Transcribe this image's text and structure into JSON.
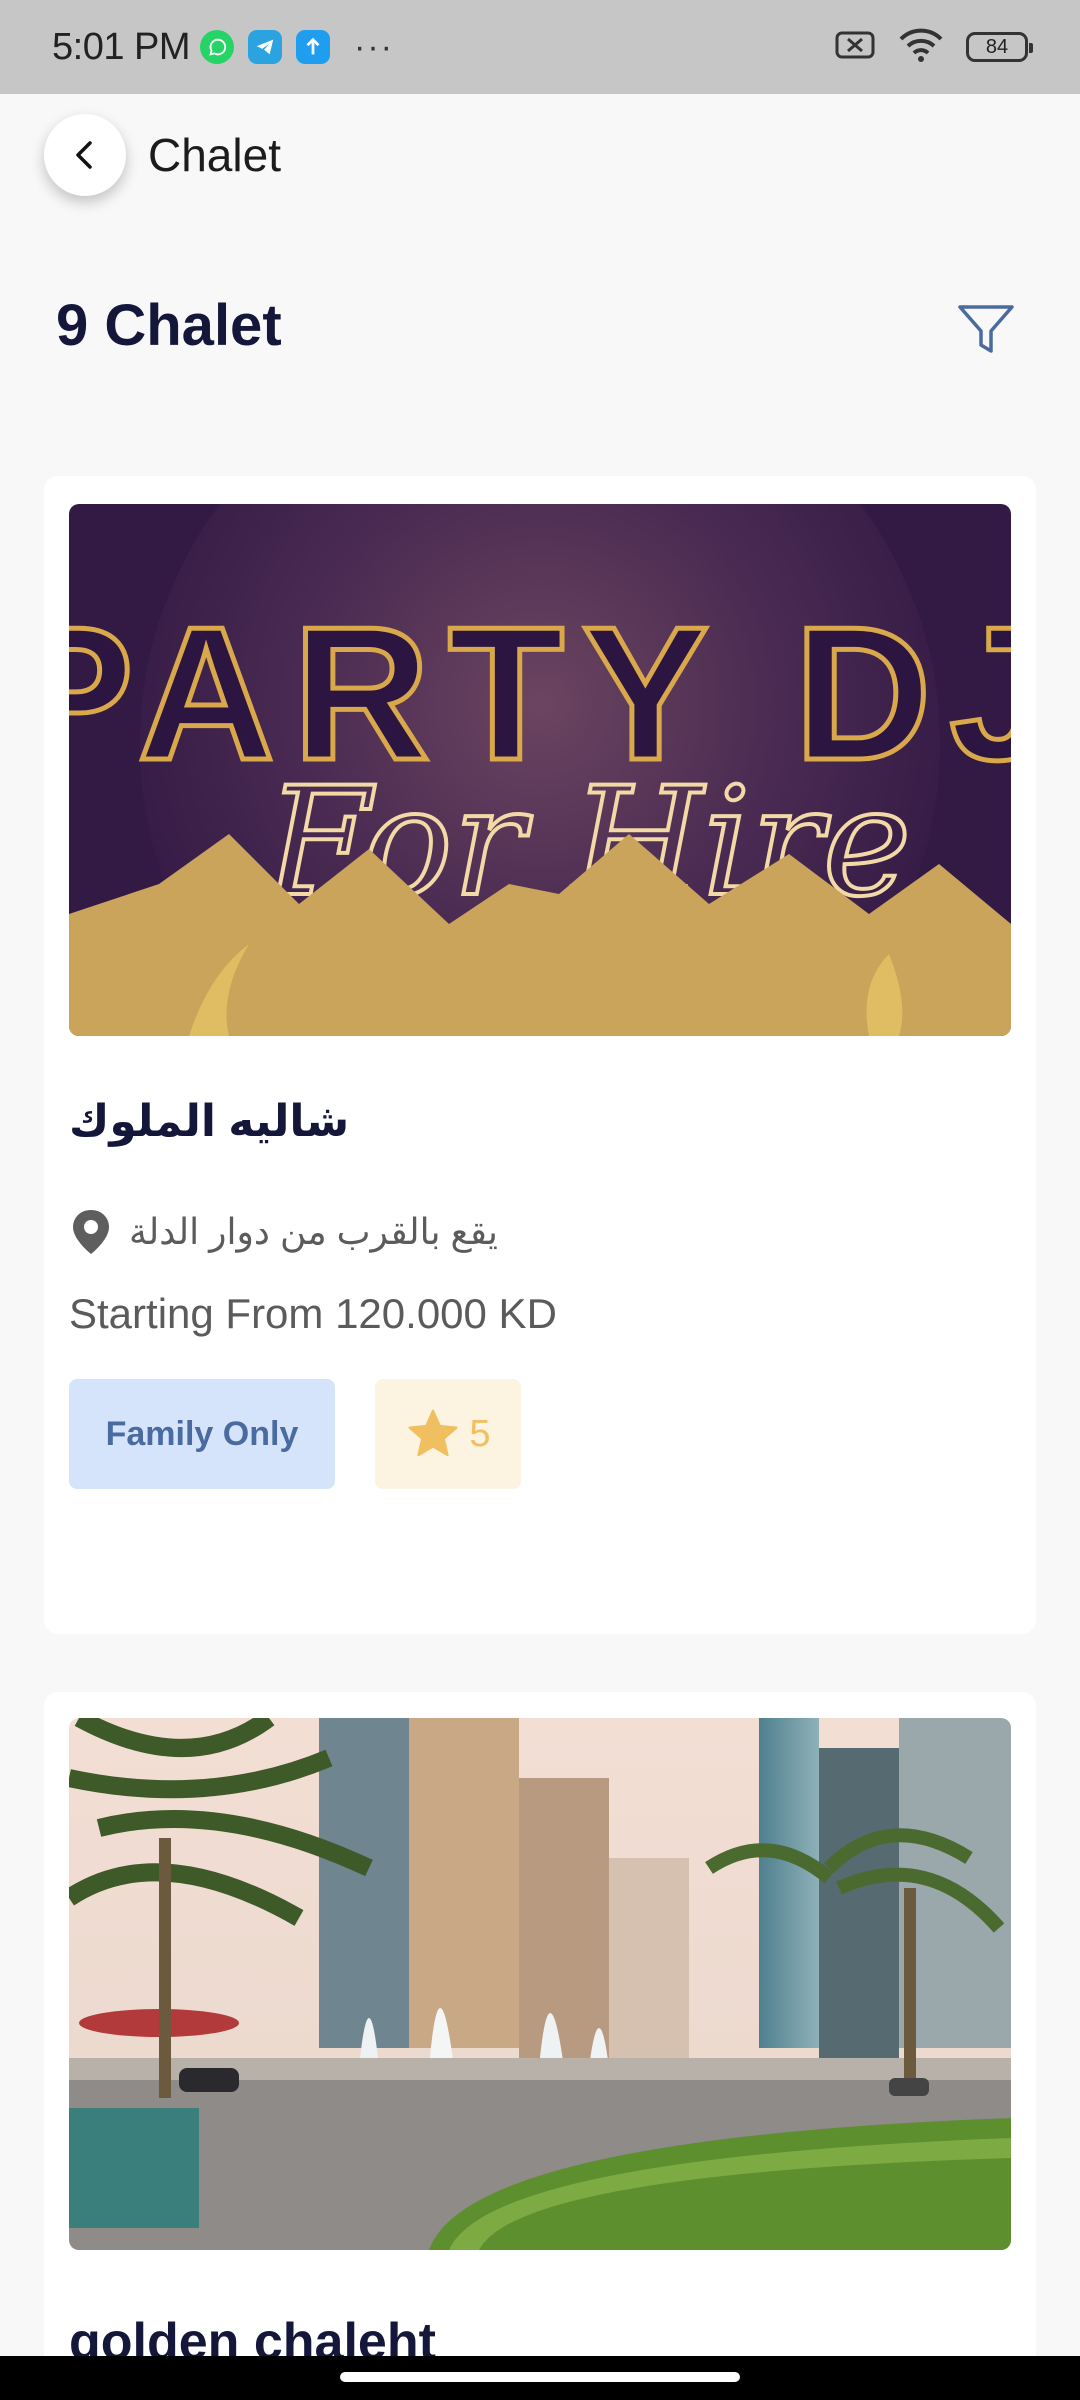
{
  "status_bar": {
    "time": "5:01 PM",
    "battery": "84",
    "more": "···",
    "apps": [
      "whatsapp-icon",
      "telegram-icon",
      "upload-icon"
    ]
  },
  "header": {
    "title": "Chalet"
  },
  "results": {
    "count_label": "9 Chalet"
  },
  "cards": [
    {
      "title": "شاليه الملوك",
      "location": "يقع بالقرب من دوار الدلة",
      "price": "Starting From 120.000 KD",
      "tag": "Family Only",
      "rating": "5",
      "image": {
        "line1": "PARTY DJ",
        "line2": "For Hire"
      }
    },
    {
      "title": "golden chaleht"
    }
  ],
  "colors": {
    "title_navy": "#14173a",
    "tag_blue_bg": "#d6e4fb",
    "tag_blue_text": "#4a6ba0",
    "rating_bg": "#fdf3e1",
    "star": "#f0c060",
    "filter_icon": "#4a6ba0"
  }
}
